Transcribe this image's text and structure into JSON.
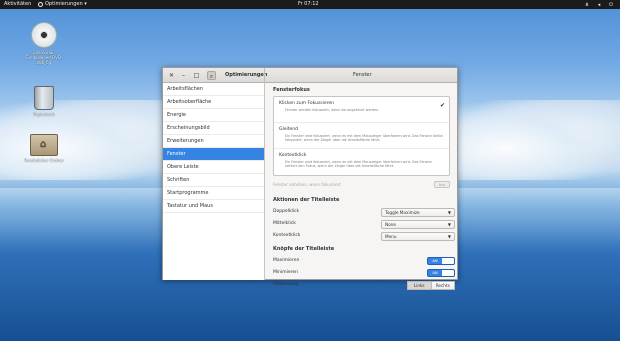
{
  "topbar": {
    "activities": "Aktivitäten",
    "app_menu": "Optimierungen ▾",
    "clock": "Fr 07:12",
    "tray_icons": [
      "network-icon",
      "volume-icon",
      "power-icon"
    ]
  },
  "desktop": {
    "icons": [
      {
        "label": "openSUSE-Tumbleweed-DVD-x86_64",
        "icon": "disc-icon"
      },
      {
        "label": "Papierkorb",
        "icon": "trash-icon"
      },
      {
        "label": "Persönlicher Ordner",
        "icon": "home-folder-icon"
      }
    ]
  },
  "window": {
    "app_title": "Optimierungen",
    "panel_title": "Fenster",
    "header_buttons": [
      "✕",
      "–",
      "□"
    ],
    "sidebar": [
      "Arbeitsflächen",
      "Arbeitsoberfläche",
      "Energie",
      "Erscheinungsbild",
      "Erweiterungen",
      "Fenster",
      "Obere Leiste",
      "Schriften",
      "Startprogramme",
      "Tastatur und Maus"
    ],
    "sidebar_active_index": 5,
    "focus": {
      "heading": "Fensterfokus",
      "options": [
        {
          "title": "Klicken zum Fokussieren",
          "desc": "Fenster werden fokussiert, wenn sie angeklickt werden.",
          "checked": true
        },
        {
          "title": "Gleitend",
          "desc": "Ein Fenster wird fokussiert, wenn es mit dem Mauszeiger überfahren wird. Das Fenster bleibt fokussiert, wenn der Zeiger über die Arbeitsfläche fährt.",
          "checked": false
        },
        {
          "title": "Kontextklick",
          "desc": "Ein Fenster wird fokussiert, wenn es mit dem Mauszeiger überfahren wird. Das Fenster verliert den Fokus, wenn der Zeiger über die Arbeitsfläche fährt.",
          "checked": false
        }
      ],
      "raise_label": "Fenster anheben, wenn fokussiert",
      "raise_value": "Aus"
    },
    "titlebar_actions": {
      "heading": "Aktionen der Titelleiste",
      "rows": [
        {
          "label": "Doppelklick",
          "value": "Toggle Maximize"
        },
        {
          "label": "Mittelklick",
          "value": "None"
        },
        {
          "label": "Kontextklick",
          "value": "Menu"
        }
      ]
    },
    "titlebar_buttons": {
      "heading": "Knöpfe der Titelleiste",
      "maximize_label": "Maximieren",
      "minimize_label": "Minimieren",
      "switch_on_text": "AN",
      "placement_label": "Platzierung",
      "left": "Links",
      "right": "Rechts"
    }
  }
}
